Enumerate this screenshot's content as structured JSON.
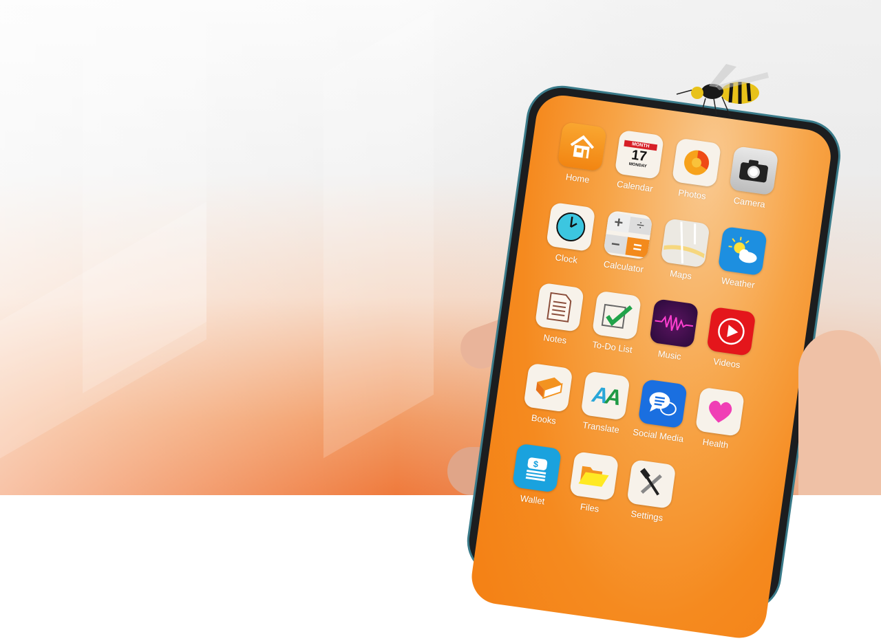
{
  "scene": {
    "description": "Hand holding a smartphone with orange home screen; a wasp sits on top of the phone",
    "background_accent": "#ef7a3c",
    "screen_color": "#f58a1f"
  },
  "apps": [
    {
      "label": "Home",
      "icon": "house-icon"
    },
    {
      "label": "Calendar",
      "icon": "calendar-icon",
      "month": "MONTH",
      "day": "17",
      "weekday": "MONDAY"
    },
    {
      "label": "Photos",
      "icon": "flower-icon"
    },
    {
      "label": "Camera",
      "icon": "camera-icon"
    },
    {
      "label": "Clock",
      "icon": "clock-icon"
    },
    {
      "label": "Calculator",
      "icon": "calculator-icon"
    },
    {
      "label": "Maps",
      "icon": "map-icon"
    },
    {
      "label": "Weather",
      "icon": "sun-cloud-icon"
    },
    {
      "label": "Notes",
      "icon": "document-icon"
    },
    {
      "label": "To-Do List",
      "icon": "checkbox-icon"
    },
    {
      "label": "Music",
      "icon": "waveform-icon"
    },
    {
      "label": "Videos",
      "icon": "play-icon"
    },
    {
      "label": "Books",
      "icon": "book-icon"
    },
    {
      "label": "Translate",
      "icon": "letters-icon",
      "glyph": "AA"
    },
    {
      "label": "Social Media",
      "icon": "chat-bubbles-icon"
    },
    {
      "label": "Health",
      "icon": "heart-icon"
    },
    {
      "label": "Wallet",
      "icon": "money-icon"
    },
    {
      "label": "Files",
      "icon": "folder-icon"
    },
    {
      "label": "Settings",
      "icon": "tools-icon"
    }
  ]
}
